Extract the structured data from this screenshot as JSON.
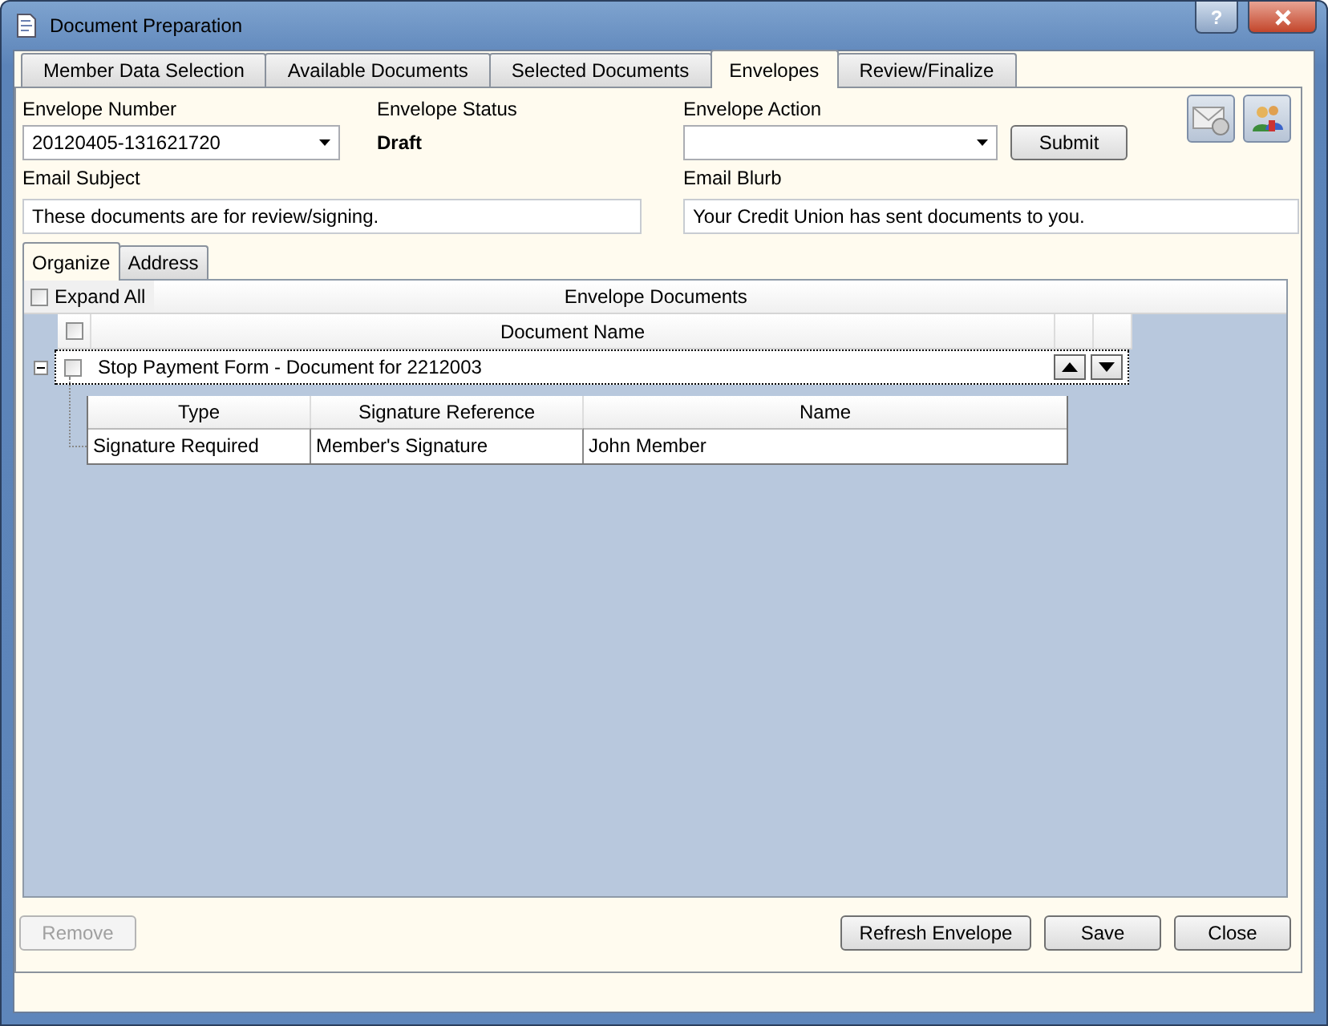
{
  "window": {
    "title": "Document Preparation",
    "help_button": "?"
  },
  "tabs": [
    {
      "label": "Member Data Selection",
      "selected": false
    },
    {
      "label": "Available Documents",
      "selected": false
    },
    {
      "label": "Selected Documents",
      "selected": false
    },
    {
      "label": "Envelopes",
      "selected": true
    },
    {
      "label": "Review/Finalize",
      "selected": false
    }
  ],
  "envelope_number": {
    "label": "Envelope Number",
    "value": "20120405-131621720"
  },
  "envelope_status": {
    "label": "Envelope Status",
    "value": "Draft"
  },
  "envelope_action": {
    "label": "Envelope Action",
    "submit": "Submit"
  },
  "email_subject": {
    "label": "Email Subject",
    "value": "These documents are for review/signing."
  },
  "email_blurb": {
    "label": "Email Blurb",
    "value": "Your Credit Union has sent documents to you."
  },
  "subtabs": [
    {
      "label": "Organize",
      "selected": true
    },
    {
      "label": "Address",
      "selected": false
    }
  ],
  "grid": {
    "expand_all": {
      "label": "Expand All",
      "checked": false
    },
    "title": "Envelope Documents",
    "column": "Document Name",
    "header_checked": false,
    "rows": [
      {
        "name": "Stop Payment Form - Document for 2212003",
        "checked": false,
        "expanded": true,
        "signatures": {
          "columns": [
            "Type",
            "Signature Reference",
            "Name"
          ],
          "rows": [
            [
              "Signature Required",
              "Member's Signature",
              "John Member"
            ]
          ]
        }
      }
    ]
  },
  "buttons": [
    {
      "label": "Remove",
      "disabled": true
    },
    {
      "label": "Refresh Envelope",
      "disabled": false
    },
    {
      "label": "Save",
      "disabled": false
    },
    {
      "label": "Close",
      "disabled": false
    }
  ]
}
